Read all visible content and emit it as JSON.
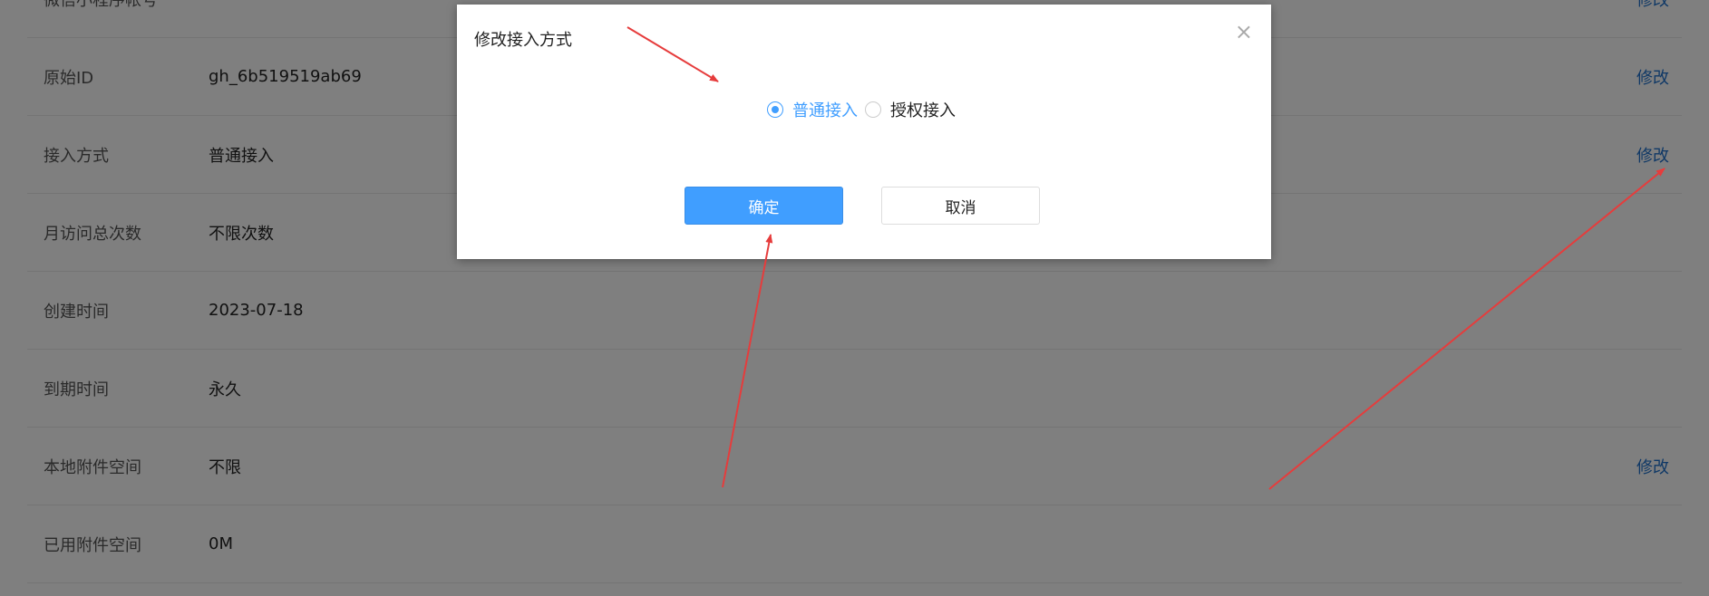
{
  "rows": [
    {
      "label": "微信小程序帐号",
      "value": "",
      "action": "修改"
    },
    {
      "label": "原始ID",
      "value": "gh_6b519519ab69",
      "action": "修改"
    },
    {
      "label": "接入方式",
      "value": "普通接入",
      "action": "修改"
    },
    {
      "label": "月访问总次数",
      "value": "不限次数",
      "action": ""
    },
    {
      "label": "创建时间",
      "value": "2023-07-18",
      "action": ""
    },
    {
      "label": "到期时间",
      "value": "永久",
      "action": ""
    },
    {
      "label": "本地附件空间",
      "value": "不限",
      "action": "修改"
    },
    {
      "label": "已用附件空间",
      "value": "0M",
      "action": ""
    }
  ],
  "modal": {
    "title": "修改接入方式",
    "close_symbol": "×",
    "options": [
      {
        "label": "普通接入",
        "checked": true
      },
      {
        "label": "授权接入",
        "checked": false
      }
    ],
    "confirm_label": "确定",
    "cancel_label": "取消"
  },
  "colors": {
    "accent": "#409eff",
    "link": "#1e70cd",
    "arrow": "#e63c3c"
  }
}
